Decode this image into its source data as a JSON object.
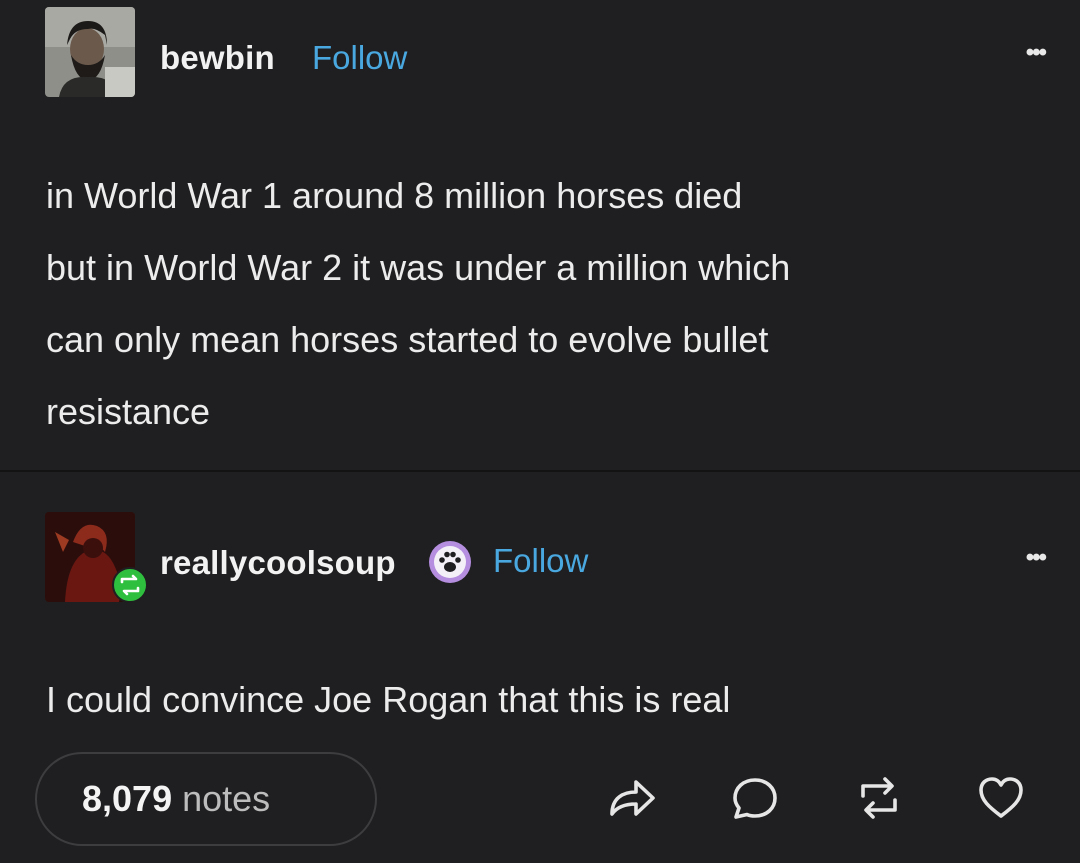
{
  "post1": {
    "username": "bewbin",
    "follow_label": "Follow",
    "more_label": "•••",
    "body": "in World War 1 around 8 million horses died\nbut in World War 2 it was under a million which\ncan only mean horses started to evolve bullet\nresistance"
  },
  "post2": {
    "username": "reallycoolsoup",
    "follow_label": "Follow",
    "more_label": "•••",
    "body": "I could convince Joe Rogan that this is real"
  },
  "footer": {
    "notes_count": "8,079",
    "notes_label": "notes"
  },
  "icons": [
    "share-icon",
    "reply-icon",
    "reblog-icon",
    "heart-icon",
    "reblog-badge-icon",
    "paw-badge-icon",
    "more-icon"
  ],
  "colors": {
    "background": "#1f1f21",
    "follow": "#4aa8e0",
    "reblog_badge": "#2fbf3f",
    "paw_badge": "#b58ee0"
  }
}
